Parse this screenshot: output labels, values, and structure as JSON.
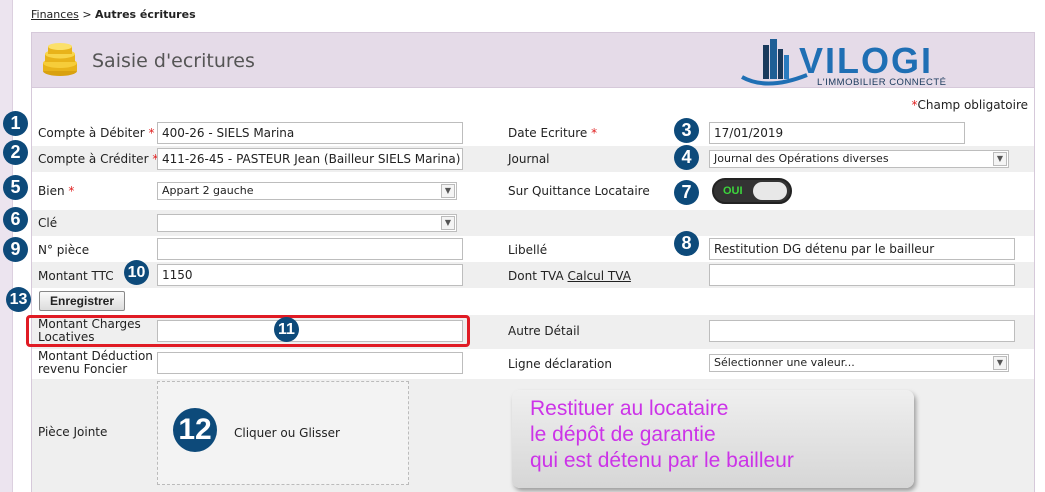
{
  "breadcrumb": {
    "parent": "Finances",
    "separator": " > ",
    "current": "Autres écritures"
  },
  "panel": {
    "title": "Saisie d'ecritures",
    "icon": "coins-icon"
  },
  "logo": {
    "text": "VILOGI",
    "tagline": "L'IMMOBILIER CONNECTÉ"
  },
  "required_note": {
    "star": "*",
    "text": "Champ obligatoire"
  },
  "form": {
    "compte_debiter": {
      "label": "Compte à Débiter",
      "star": "*",
      "value": "400-26 - SIELS Marina"
    },
    "compte_crediter": {
      "label": "Compte à Créditer",
      "star": "*",
      "value": "411-26-45 - PASTEUR Jean (Bailleur SIELS Marina)"
    },
    "bien": {
      "label": "Bien",
      "star": "*",
      "value": "Appart 2 gauche"
    },
    "cle": {
      "label": "Clé",
      "value": ""
    },
    "num_piece": {
      "label": "N° pièce",
      "value": ""
    },
    "montant_ttc": {
      "label": "Montant TTC",
      "value": "1150"
    },
    "date_ecriture": {
      "label": "Date Ecriture",
      "star": "*",
      "value": "17/01/2019"
    },
    "journal": {
      "label": "Journal",
      "value": "Journal des Opérations diverses"
    },
    "sur_quittance": {
      "label": "Sur Quittance Locataire",
      "toggle": "OUI"
    },
    "libelle": {
      "label": "Libellé",
      "value": "Restitution DG détenu par le bailleur"
    },
    "dont_tva": {
      "label": "Dont TVA",
      "link": "Calcul TVA",
      "value": ""
    },
    "save_button": "Enregistrer",
    "charges_locatives": {
      "label_line1": "Montant Charges",
      "label_line2": "Locatives",
      "value": ""
    },
    "autre_detail": {
      "label": "Autre Détail",
      "value": ""
    },
    "deduction": {
      "label_line1": "Montant Déduction",
      "label_line2": "revenu Foncier",
      "value": ""
    },
    "ligne_declaration": {
      "label": "Ligne déclaration",
      "value": "Sélectionner une valeur..."
    },
    "piece_jointe": {
      "label": "Pièce Jointe",
      "drop_text": "Cliquer ou Glisser"
    }
  },
  "badges": [
    "1",
    "2",
    "3",
    "4",
    "5",
    "6",
    "7",
    "8",
    "9",
    "10",
    "11",
    "12",
    "13"
  ],
  "callout": {
    "line1": "Restituer au locataire",
    "line2": "le dépôt de garantie",
    "line3": "qui est détenu par le bailleur"
  },
  "colors": {
    "badge": "#0d4a7a",
    "header": "#e5dbe8",
    "required": "#e02020",
    "callout_text": "#cc33e8",
    "highlight": "#e01b24"
  }
}
